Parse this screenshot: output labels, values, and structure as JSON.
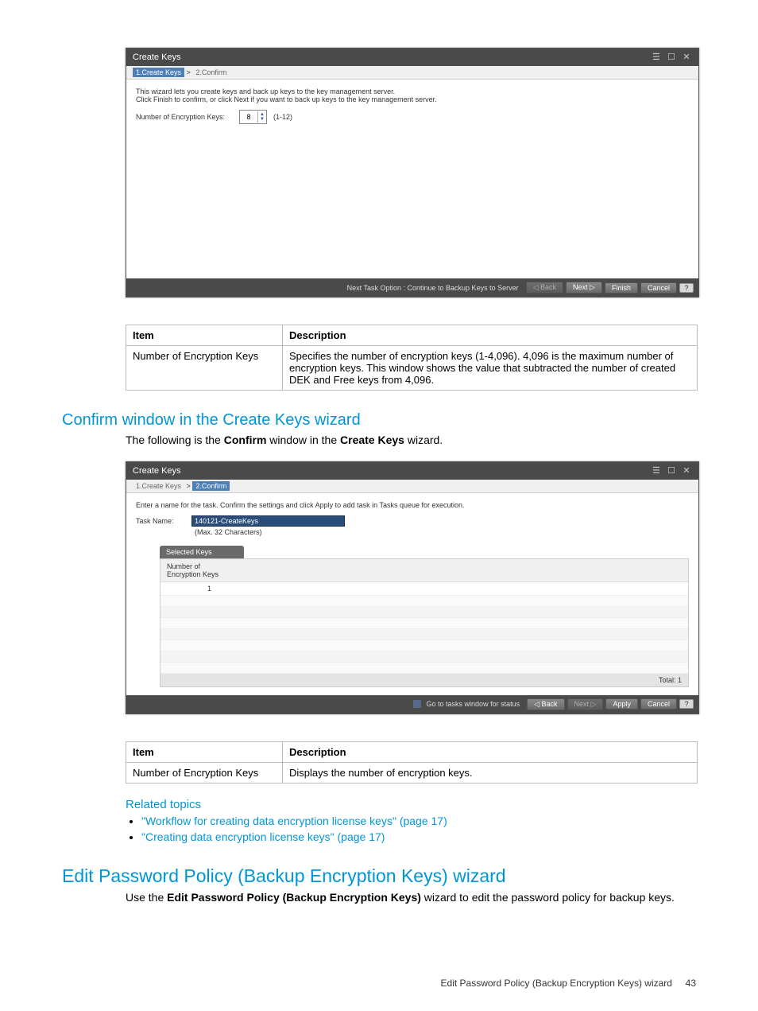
{
  "wizard1": {
    "title": "Create Keys",
    "breadcrumb_step1": "1.Create Keys",
    "breadcrumb_sep": ">",
    "breadcrumb_step2": "2.Confirm",
    "desc_line1": "This wizard lets you create keys and back up keys to the key management server.",
    "desc_line2": "Click Finish to confirm, or click Next if you want to back up keys to the key management server.",
    "num_keys_label": "Number of Encryption Keys:",
    "num_keys_value": "8",
    "range_hint": "(1-12)",
    "footer_text": "Next Task Option : Continue to Backup Keys to Server",
    "btn_back": "◁ Back",
    "btn_next": "Next ▷",
    "btn_finish": "Finish",
    "btn_cancel": "Cancel",
    "help": "?"
  },
  "table1": {
    "h_item": "Item",
    "h_desc": "Description",
    "r1_item": "Number of Encryption Keys",
    "r1_desc": "Specifies the number of encryption keys (1-4,096). 4,096 is the maximum number of encryption keys. This window shows the value that subtracted the number of created DEK and Free keys from 4,096."
  },
  "heading1": "Confirm window in the Create Keys wizard",
  "para1_pre": "The following is the ",
  "para1_b1": "Confirm",
  "para1_mid": " window in the ",
  "para1_b2": "Create Keys",
  "para1_post": " wizard.",
  "wizard2": {
    "title": "Create Keys",
    "breadcrumb_step1": "1.Create Keys",
    "breadcrumb_sep": ">",
    "breadcrumb_step2": "2.Confirm",
    "desc_line1": "Enter a name for the task. Confirm the settings and click Apply to add task in Tasks queue for execution.",
    "task_label": "Task Name:",
    "task_value": "140121-CreateKeys",
    "max_hint": "(Max. 32 Characters)",
    "selected_keys_label": "Selected Keys",
    "sk_sub_label": "Number of\nEncryption Keys",
    "sk_value": "1",
    "total_label": "Total: 1",
    "go_tasks": "Go to tasks window for status",
    "btn_back": "◁ Back",
    "btn_next": "Next ▷",
    "btn_apply": "Apply",
    "btn_cancel": "Cancel",
    "help": "?"
  },
  "table2": {
    "h_item": "Item",
    "h_desc": "Description",
    "r1_item": "Number of Encryption Keys",
    "r1_desc": "Displays the number of encryption keys."
  },
  "related_heading": "Related topics",
  "link1": "\"Workflow for creating data encryption license keys\" (page 17)",
  "link2": "\"Creating data encryption license keys\" (page 17)",
  "heading2": "Edit Password Policy (Backup Encryption Keys) wizard",
  "para2_pre": "Use the ",
  "para2_b": "Edit Password Policy (Backup Encryption Keys)",
  "para2_post": " wizard to edit the password policy for backup keys.",
  "footer_text": "Edit Password Policy (Backup Encryption Keys) wizard",
  "footer_page": "43"
}
